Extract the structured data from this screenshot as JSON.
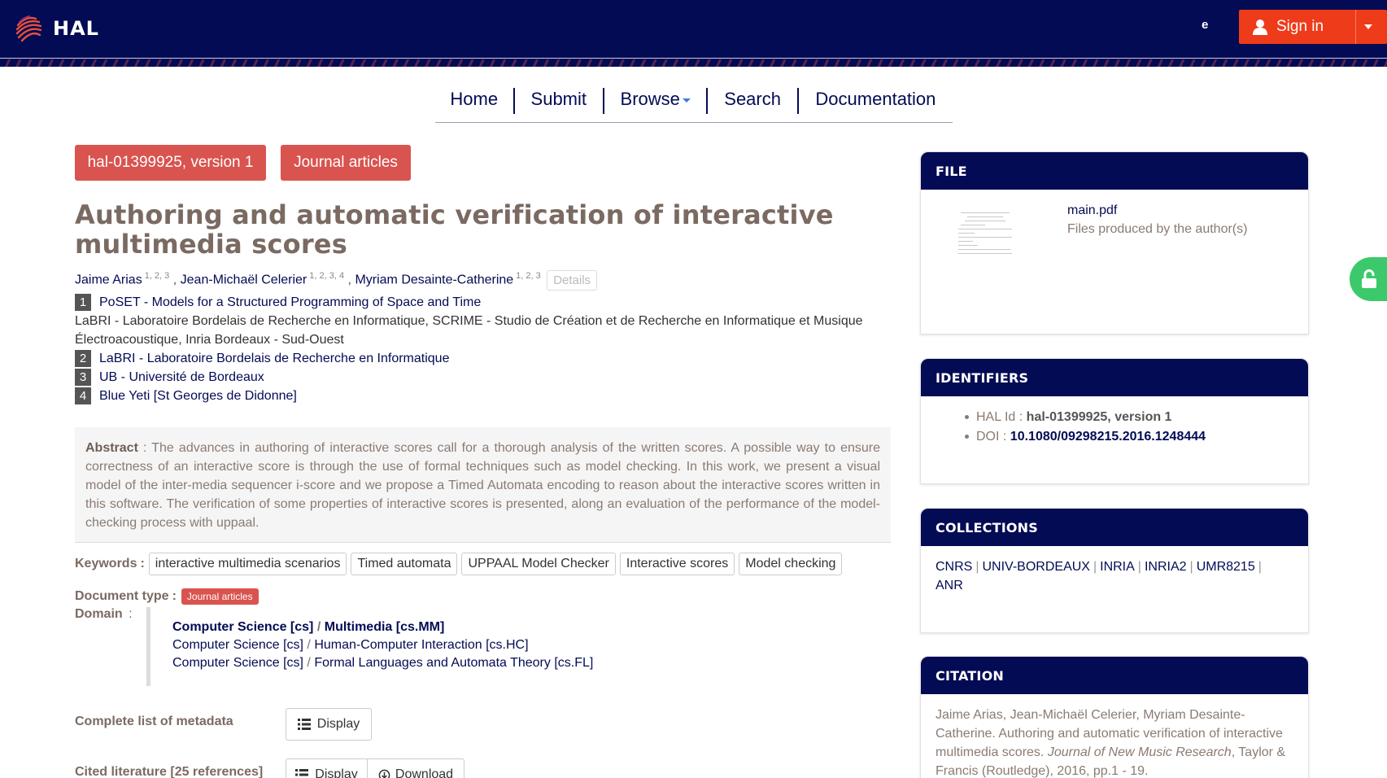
{
  "header": {
    "logo_text": "HAL",
    "lang": "e",
    "signin_label": "Sign in",
    "brand_color": "#030b54",
    "signin_color": "#ee3b1a"
  },
  "nav": {
    "items": [
      "Home",
      "Submit",
      "Browse",
      "Search",
      "Documentation"
    ]
  },
  "record": {
    "hal_version_label": "hal-01399925, version 1",
    "type_label": "Journal articles",
    "title": "Authoring and automatic verification of interactive multimedia scores",
    "authors": [
      {
        "name": "Jaime Arias",
        "affs": "1, 2, 3"
      },
      {
        "name": "Jean-Michaël Celerier",
        "affs": "1, 2, 3, 4"
      },
      {
        "name": "Myriam Desainte-Catherine",
        "affs": "1, 2, 3"
      }
    ],
    "author_sep": ",",
    "details_label": "Details",
    "affiliations": [
      {
        "num": "1",
        "name": "PoSET - Models for a Structured Programming of Space and Time",
        "sub": "LaBRI - Laboratoire Bordelais de Recherche en Informatique, SCRIME - Studio de Création et de Recherche en Informatique et Musique Électroacoustique, Inria Bordeaux - Sud-Ouest"
      },
      {
        "num": "2",
        "name": "LaBRI - Laboratoire Bordelais de Recherche en Informatique"
      },
      {
        "num": "3",
        "name": "UB - Université de Bordeaux"
      },
      {
        "num": "4",
        "name": "Blue Yeti [St Georges de Didonne]"
      }
    ],
    "abstract_label": "Abstract",
    "abstract_text": " : The advances in authoring of interactive scores call for a thorough analysis of the written scores. A possible way to ensure correctness of an interactive score is through the use of formal techniques such as model checking. In this work, we present a visual model of the inter-media sequencer i-score and we propose a Timed Automata encoding to reason about the interactive scores written in this software. The verification of some properties of interactive scores is presented, along an evaluation of the performance of the model-checking process with uppaal.",
    "keywords_label": "Keywords",
    "label_colon": ":",
    "keywords": [
      "interactive multimedia scenarios",
      "Timed automata",
      "UPPAAL Model Checker",
      "Interactive scores",
      "Model checking"
    ],
    "doctype_label": "Document type",
    "doctype_value": "Journal articles",
    "domain_label": "Domain",
    "domains": [
      {
        "a": "Computer Science [cs]",
        "b": "Multimedia [cs.MM]"
      },
      {
        "a": "Computer Science [cs]",
        "b": "Human-Computer Interaction [cs.HC]"
      },
      {
        "a": "Computer Science [cs]",
        "b": "Formal Languages and Automata Theory [cs.FL]"
      }
    ],
    "domain_sep": "/",
    "metadata_label": "Complete list of metadata",
    "display_label": "Display",
    "cited_label": "Cited literature [25 references]",
    "download_label": "Download"
  },
  "sidebar": {
    "file": {
      "head": "FILE",
      "name": "main.pdf",
      "sub": "Files produced by the author(s)"
    },
    "identifiers": {
      "head": "IDENTIFIERS",
      "hal_label": "HAL Id :",
      "hal_value": "hal-01399925, version 1",
      "doi_label": "DOI :",
      "doi_value": "10.1080/09298215.2016.1248444"
    },
    "collections": {
      "head": "COLLECTIONS",
      "items": [
        "CNRS",
        "UNIV-BORDEAUX",
        "INRIA",
        "INRIA2",
        "UMR8215",
        "ANR"
      ],
      "sep": "|"
    },
    "citation": {
      "head": "CITATION",
      "authors": "Jaime Arias, Jean-Michaël Celerier, Myriam Desainte-Catherine. Authoring and automatic verification of interactive multimedia scores. ",
      "journal": "Journal of New Music Research",
      "rest": ", Taylor & Francis (Routledge), 2016, pp.1 - 19."
    }
  }
}
